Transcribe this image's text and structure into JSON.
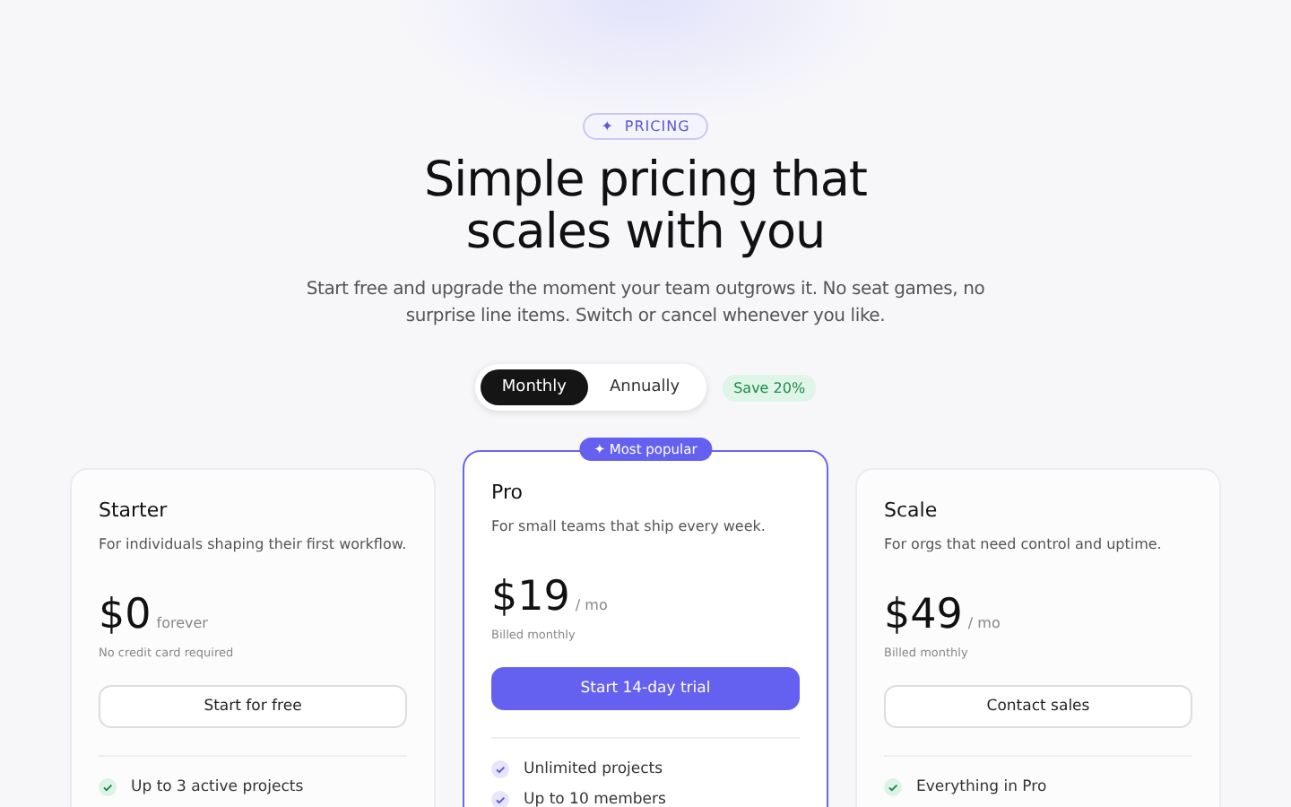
{
  "eyebrow": {
    "icon": "✦",
    "label": "PRICING"
  },
  "title": "Simple pricing that scales with you",
  "subtitle": "Start free and upgrade the moment your team outgrows it. No seat games, no surprise line items. Switch or cancel whenever you like.",
  "billing_toggle": [
    {
      "label": "Monthly",
      "selected": true
    },
    {
      "label": "Annually",
      "selected": false
    }
  ],
  "save_badge": "Save 20%",
  "plans": [
    {
      "name": "Starter",
      "featured": false,
      "description": "For individuals shaping their first workflow.",
      "price": "$0",
      "period": "forever",
      "note": "No credit card required",
      "button": "Start for free",
      "features": [
        "Up to 3 active projects"
      ]
    },
    {
      "name": "Pro",
      "featured": true,
      "ribbon": "✦ Most popular",
      "description": "For small teams that ship every week.",
      "price": "$19",
      "period": "/ mo",
      "note": "Billed monthly",
      "button": "Start 14-day trial",
      "features": [
        "Unlimited projects",
        "Up to 10 members"
      ]
    },
    {
      "name": "Scale",
      "featured": false,
      "description": "For orgs that need control and uptime.",
      "price": "$49",
      "period": "/ mo",
      "note": "Billed monthly",
      "button": "Contact sales",
      "features": [
        "Everything in Pro"
      ]
    }
  ]
}
